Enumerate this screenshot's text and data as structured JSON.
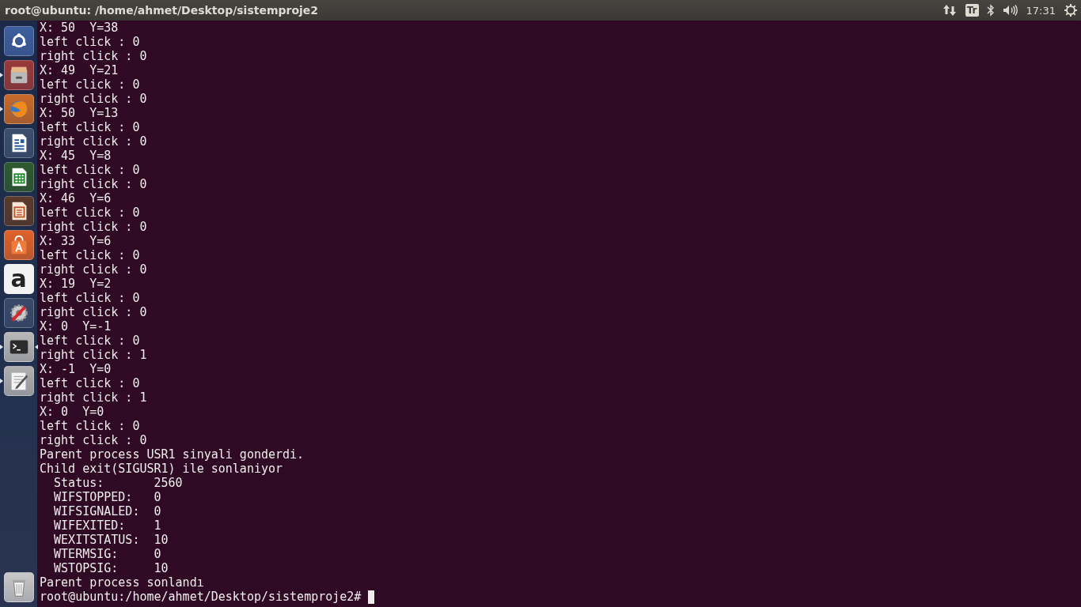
{
  "top_panel": {
    "title": "root@ubuntu: /home/ahmet/Desktop/sistemproje2",
    "keyboard_layout": "Tr",
    "clock": "17:31"
  },
  "launcher": {
    "items": [
      {
        "kind": "dash",
        "running": false,
        "focused": false
      },
      {
        "kind": "files",
        "running": true,
        "focused": false
      },
      {
        "kind": "browser",
        "running": true,
        "focused": false
      },
      {
        "kind": "writer",
        "running": false,
        "focused": false
      },
      {
        "kind": "calc",
        "running": false,
        "focused": false
      },
      {
        "kind": "impress",
        "running": false,
        "focused": false
      },
      {
        "kind": "software",
        "running": false,
        "focused": false
      },
      {
        "kind": "store",
        "running": false,
        "focused": false,
        "glyph": "a"
      },
      {
        "kind": "settings",
        "running": false,
        "focused": false
      },
      {
        "kind": "terminal",
        "running": true,
        "focused": true
      },
      {
        "kind": "editor",
        "running": true,
        "focused": false
      }
    ],
    "trash": {
      "kind": "trash"
    }
  },
  "terminal": {
    "lines": [
      "X: 50  Y=38",
      "left click : 0",
      "right click : 0",
      "X: 49  Y=21",
      "left click : 0",
      "right click : 0",
      "X: 50  Y=13",
      "left click : 0",
      "right click : 0",
      "X: 45  Y=8",
      "left click : 0",
      "right click : 0",
      "X: 46  Y=6",
      "left click : 0",
      "right click : 0",
      "X: 33  Y=6",
      "left click : 0",
      "right click : 0",
      "X: 19  Y=2",
      "left click : 0",
      "right click : 0",
      "X: 0  Y=-1",
      "left click : 0",
      "right click : 1",
      "X: -1  Y=0",
      "left click : 0",
      "right click : 1",
      "X: 0  Y=0",
      "left click : 0",
      "right click : 0",
      "Parent process USR1 sinyali gonderdi.",
      "Child exit(SIGUSR1) ile sonlaniyor",
      "  Status:       2560",
      "  WIFSTOPPED:   0",
      "  WIFSIGNALED:  0",
      "  WIFEXITED:    1",
      "  WEXITSTATUS:  10",
      "  WTERMSIG:     0",
      "  WSTOPSIG:     10",
      "Parent process sonlandı"
    ],
    "prompt": "root@ubuntu:/home/ahmet/Desktop/sistemproje2# "
  }
}
